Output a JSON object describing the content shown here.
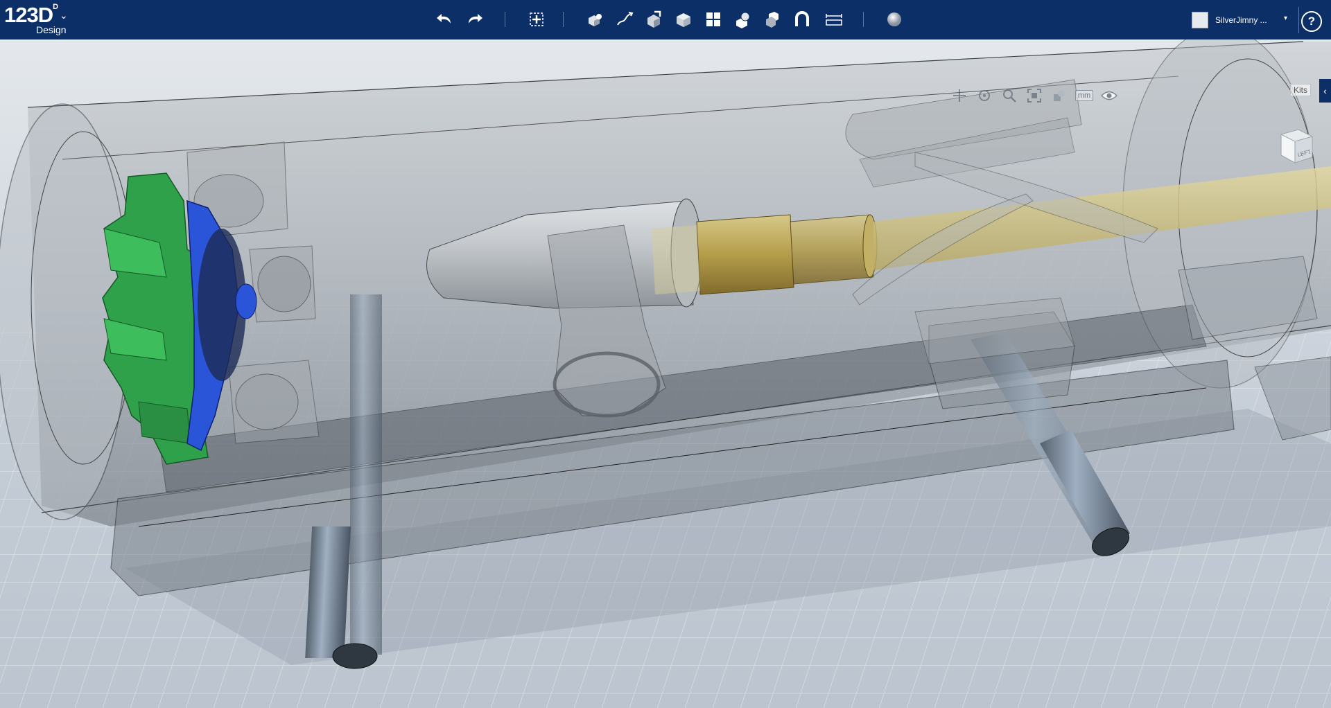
{
  "app": {
    "logo_main": "123D",
    "logo_sub": "Design",
    "logo_caret": "⌄"
  },
  "toolbar": {
    "items": [
      {
        "name": "undo-icon"
      },
      {
        "name": "redo-icon"
      },
      {
        "name": "transform-icon"
      },
      {
        "name": "primitives-icon"
      },
      {
        "name": "sketch-icon"
      },
      {
        "name": "construct-icon"
      },
      {
        "name": "modify-icon"
      },
      {
        "name": "pattern-icon"
      },
      {
        "name": "grouping-icon"
      },
      {
        "name": "combine-icon"
      },
      {
        "name": "snap-icon"
      },
      {
        "name": "measure-icon"
      },
      {
        "name": "material-icon"
      }
    ]
  },
  "user": {
    "name": "SilverJimny ...",
    "caret": "▾"
  },
  "help": {
    "label": "?"
  },
  "viewport": {
    "units": "mm",
    "kits_label": "Kits",
    "kits_tab_arrow": "‹",
    "viewcube_face": "LEFT"
  }
}
